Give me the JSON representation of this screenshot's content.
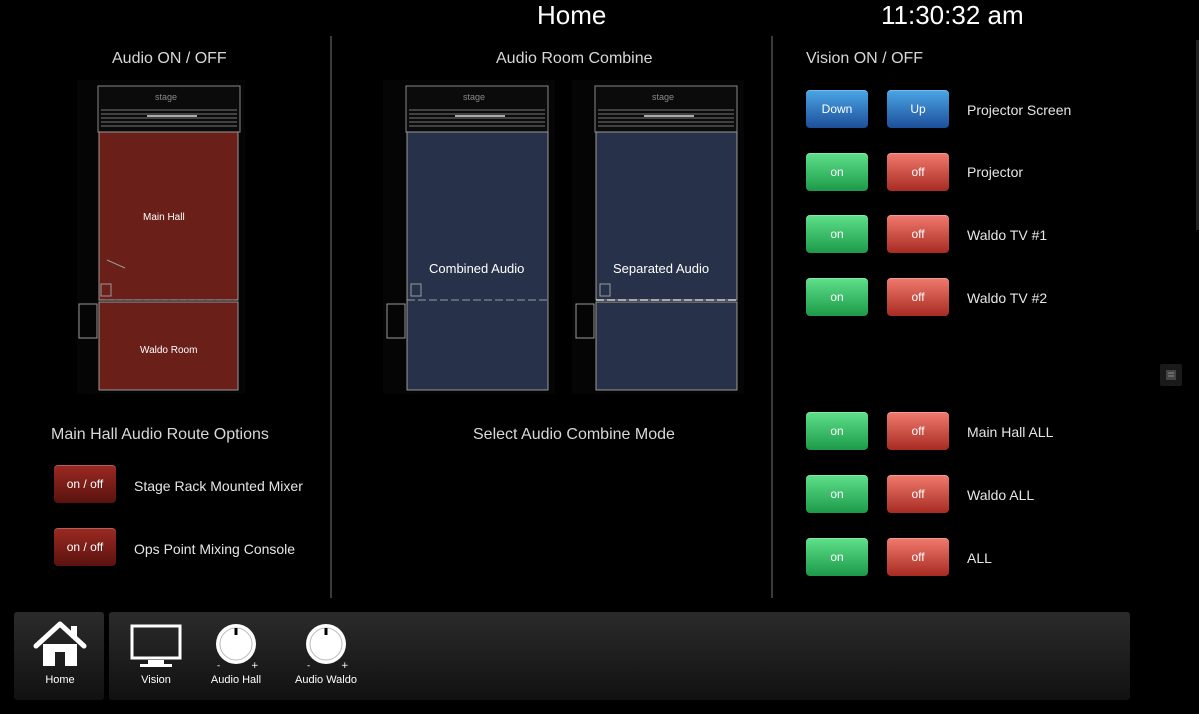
{
  "header": {
    "title": "Home",
    "clock": "11:30:32 am"
  },
  "audio_onoff": {
    "title": "Audio ON / OFF",
    "main_hall_label": "Main Hall",
    "waldo_label": "Waldo Room",
    "stage_label": "stage"
  },
  "combine": {
    "title": "Audio Room Combine",
    "combined_label": "Combined Audio",
    "separated_label": "Separated Audio",
    "stage_label": "stage",
    "mode_label": "Select Audio Combine Mode"
  },
  "route": {
    "title": "Main Hall Audio Route Options",
    "items": [
      {
        "button": "on / off",
        "label": "Stage Rack Mounted Mixer"
      },
      {
        "button": "on / off",
        "label": "Ops Point Mixing Console"
      }
    ]
  },
  "vision": {
    "title": "Vision ON / OFF",
    "screen": {
      "down": "Down",
      "up": "Up",
      "label": "Projector Screen"
    },
    "rows": [
      {
        "on": "on",
        "off": "off",
        "label": "Projector"
      },
      {
        "on": "on",
        "off": "off",
        "label": "Waldo TV #1"
      },
      {
        "on": "on",
        "off": "off",
        "label": "Waldo TV #2"
      },
      {
        "on": "on",
        "off": "off",
        "label": "Main Hall ALL"
      },
      {
        "on": "on",
        "off": "off",
        "label": "Waldo ALL"
      },
      {
        "on": "on",
        "off": "off",
        "label": "ALL"
      }
    ]
  },
  "nav": {
    "home": "Home",
    "vision": "Vision",
    "audio_hall": "Audio Hall",
    "audio_waldo": "Audio Waldo"
  },
  "colors": {
    "green": "#2fb85c",
    "red": "#c8453a",
    "blue": "#2e6ec2",
    "dark_red": "#7a1c16",
    "room_blue": "#27324a"
  }
}
